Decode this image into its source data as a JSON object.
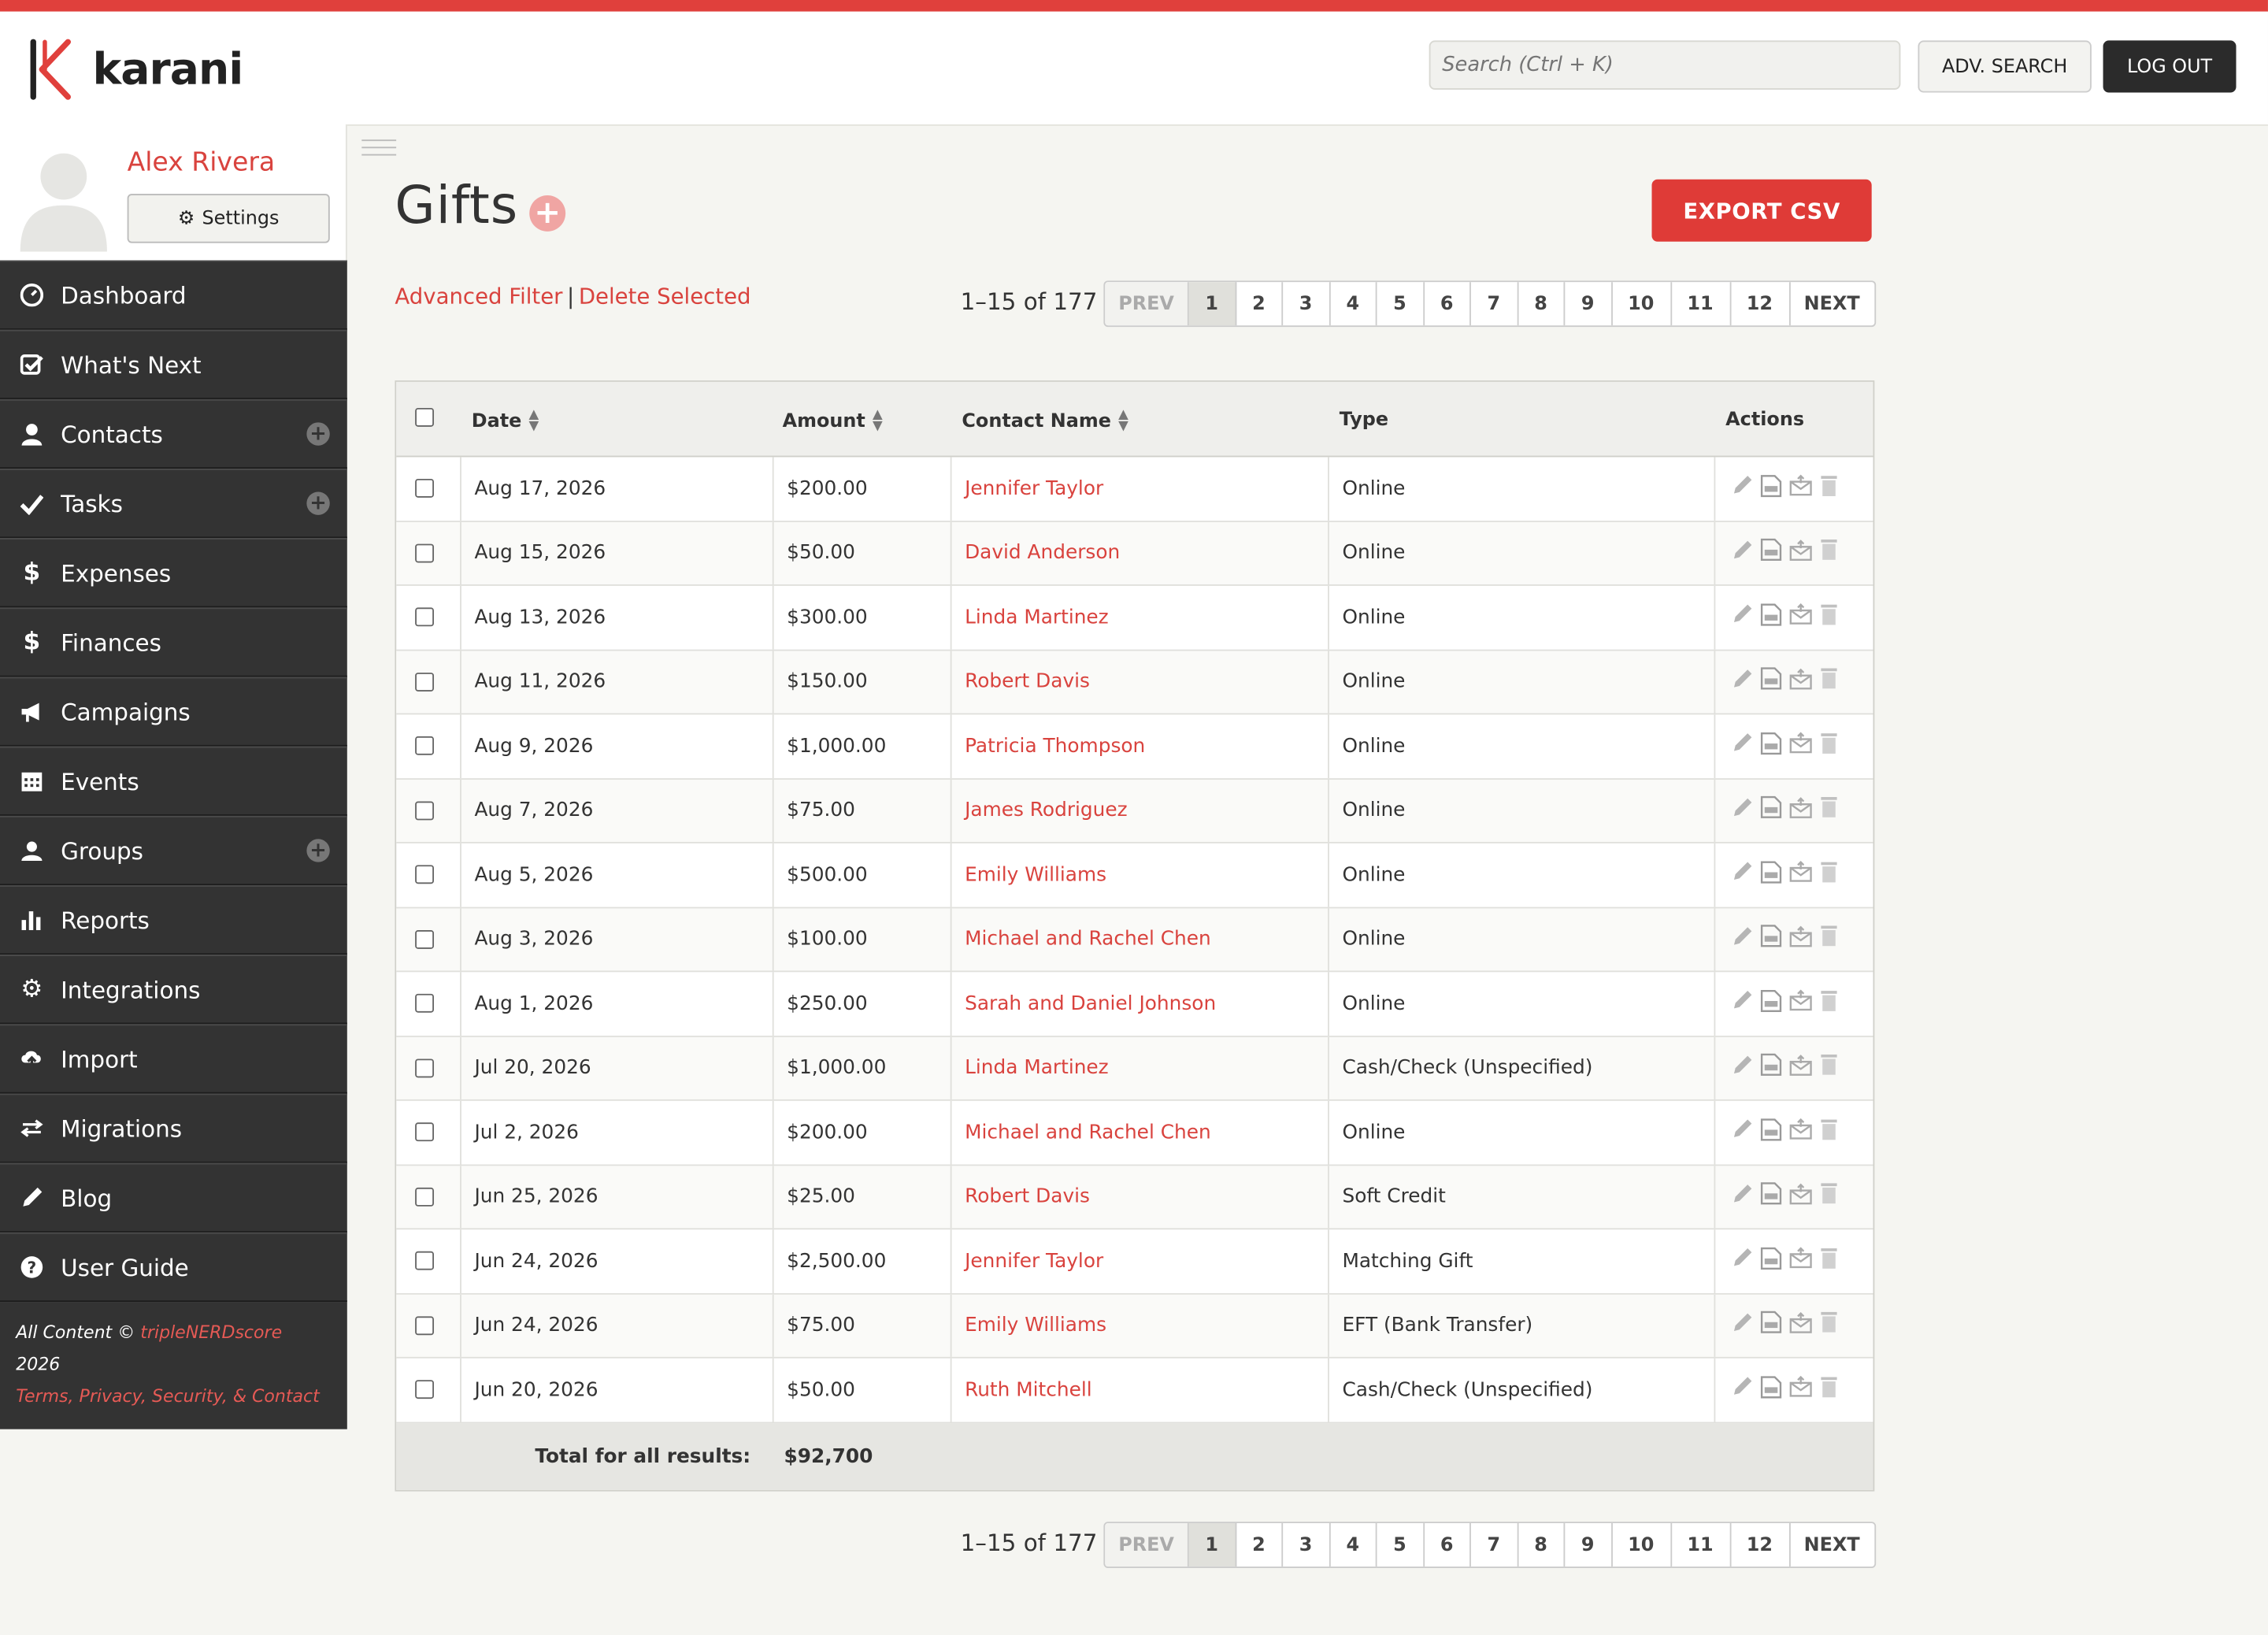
{
  "colors": {
    "accent": "#e0403c",
    "sidebar": "#333333",
    "link": "#d9433e"
  },
  "app": {
    "name": "karani"
  },
  "header": {
    "search_placeholder": "Search (Ctrl + K)",
    "adv_search_label": "ADV. SEARCH",
    "logout_label": "LOG OUT"
  },
  "profile": {
    "name": "Alex Rivera",
    "settings_label": "Settings"
  },
  "nav": [
    {
      "label": "Dashboard",
      "icon": "dashboard-icon",
      "plus": false
    },
    {
      "label": "What's Next",
      "icon": "checkbox-icon",
      "plus": false
    },
    {
      "label": "Contacts",
      "icon": "user-icon",
      "plus": true
    },
    {
      "label": "Tasks",
      "icon": "check-icon",
      "plus": true
    },
    {
      "label": "Expenses",
      "icon": "dollar-icon",
      "plus": false
    },
    {
      "label": "Finances",
      "icon": "dollar-icon",
      "plus": false
    },
    {
      "label": "Campaigns",
      "icon": "megaphone-icon",
      "plus": false
    },
    {
      "label": "Events",
      "icon": "calendar-icon",
      "plus": false
    },
    {
      "label": "Groups",
      "icon": "group-icon",
      "plus": true
    },
    {
      "label": "Reports",
      "icon": "bar-chart-icon",
      "plus": false
    },
    {
      "label": "Integrations",
      "icon": "gear-icon",
      "plus": false
    },
    {
      "label": "Import",
      "icon": "cloud-upload-icon",
      "plus": false
    },
    {
      "label": "Migrations",
      "icon": "transfer-icon",
      "plus": false
    },
    {
      "label": "Blog",
      "icon": "pencil-icon",
      "plus": false
    },
    {
      "label": "User Guide",
      "icon": "question-icon",
      "plus": false
    }
  ],
  "footer": {
    "prefix": "All Content © ",
    "company": "tripleNERDscore",
    "year": " 2026",
    "links": "Terms, Privacy, Security, & Contact"
  },
  "page": {
    "title": "Gifts",
    "export_label": "EXPORT CSV",
    "advanced_filter": "Advanced Filter",
    "separator": "|",
    "delete_selected": "Delete Selected"
  },
  "pagination": {
    "count": "1–15 of 177",
    "prev": "PREV",
    "next": "NEXT",
    "pages": [
      "1",
      "2",
      "3",
      "4",
      "5",
      "6",
      "7",
      "8",
      "9",
      "10",
      "11",
      "12"
    ],
    "current": "1"
  },
  "table": {
    "columns": {
      "date": "Date",
      "amount": "Amount",
      "contact": "Contact Name",
      "type": "Type",
      "actions": "Actions"
    },
    "rows": [
      {
        "date": "Aug 17, 2026",
        "amount": "$200.00",
        "contact": "Jennifer Taylor",
        "type": "Online"
      },
      {
        "date": "Aug 15, 2026",
        "amount": "$50.00",
        "contact": "David Anderson",
        "type": "Online"
      },
      {
        "date": "Aug 13, 2026",
        "amount": "$300.00",
        "contact": "Linda Martinez",
        "type": "Online"
      },
      {
        "date": "Aug 11, 2026",
        "amount": "$150.00",
        "contact": "Robert Davis",
        "type": "Online"
      },
      {
        "date": "Aug 9, 2026",
        "amount": "$1,000.00",
        "contact": "Patricia Thompson",
        "type": "Online"
      },
      {
        "date": "Aug 7, 2026",
        "amount": "$75.00",
        "contact": "James Rodriguez",
        "type": "Online"
      },
      {
        "date": "Aug 5, 2026",
        "amount": "$500.00",
        "contact": "Emily Williams",
        "type": "Online"
      },
      {
        "date": "Aug 3, 2026",
        "amount": "$100.00",
        "contact": "Michael and Rachel Chen",
        "type": "Online"
      },
      {
        "date": "Aug 1, 2026",
        "amount": "$250.00",
        "contact": "Sarah and Daniel Johnson",
        "type": "Online"
      },
      {
        "date": "Jul 20, 2026",
        "amount": "$1,000.00",
        "contact": "Linda Martinez",
        "type": "Cash/Check (Unspecified)"
      },
      {
        "date": "Jul 2, 2026",
        "amount": "$200.00",
        "contact": "Michael and Rachel Chen",
        "type": "Online"
      },
      {
        "date": "Jun 25, 2026",
        "amount": "$25.00",
        "contact": "Robert Davis",
        "type": "Soft Credit"
      },
      {
        "date": "Jun 24, 2026",
        "amount": "$2,500.00",
        "contact": "Jennifer Taylor",
        "type": "Matching Gift"
      },
      {
        "date": "Jun 24, 2026",
        "amount": "$75.00",
        "contact": "Emily Williams",
        "type": "EFT (Bank Transfer)"
      },
      {
        "date": "Jun 20, 2026",
        "amount": "$50.00",
        "contact": "Ruth Mitchell",
        "type": "Cash/Check (Unspecified)"
      }
    ],
    "total_label": "Total for all results:",
    "total_value": "$92,700"
  }
}
